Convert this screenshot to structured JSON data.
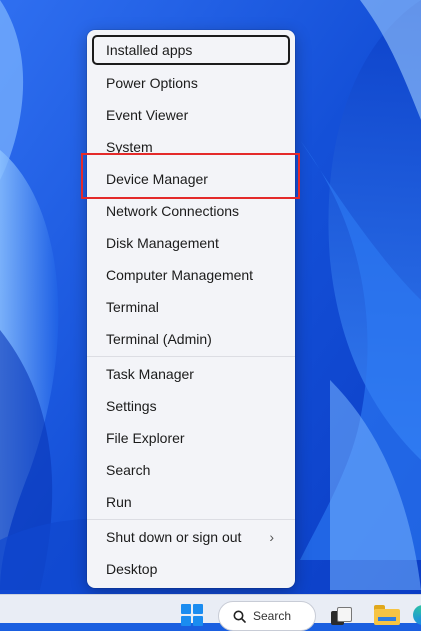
{
  "menu": {
    "items": [
      {
        "label": "Installed apps"
      },
      {
        "label": "Power Options"
      },
      {
        "label": "Event Viewer"
      },
      {
        "label": "System"
      },
      {
        "label": "Device Manager"
      },
      {
        "label": "Network Connections"
      },
      {
        "label": "Disk Management"
      },
      {
        "label": "Computer Management"
      },
      {
        "label": "Terminal"
      },
      {
        "label": "Terminal (Admin)"
      },
      {
        "label": "Task Manager"
      },
      {
        "label": "Settings"
      },
      {
        "label": "File Explorer"
      },
      {
        "label": "Search"
      },
      {
        "label": "Run"
      },
      {
        "label": "Shut down or sign out"
      },
      {
        "label": "Desktop"
      }
    ],
    "focused_item": "Installed apps",
    "highlighted_item": "Device Manager",
    "submenu_icon": "chevron-right-icon"
  },
  "taskbar": {
    "search_label": "Search",
    "icons": [
      "windows-start-icon",
      "search-icon",
      "task-view-icon",
      "file-explorer-icon",
      "edge-icon"
    ]
  },
  "colors": {
    "highlight_box": "#e42a2a",
    "menu_background": "#f3f4f8",
    "wallpaper_blue": "#1a5fe0"
  }
}
